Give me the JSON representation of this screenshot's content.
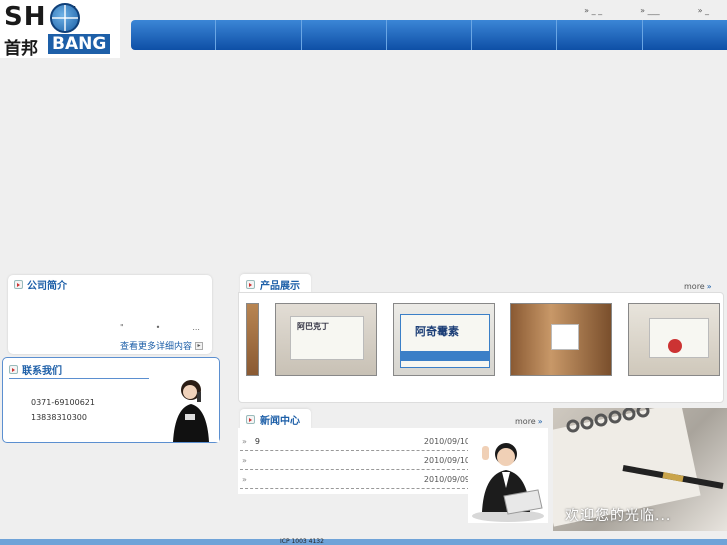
{
  "header": {
    "logo_latin": "SH U",
    "logo_cn": "首邦",
    "logo_badge": "BANG",
    "toplinks": [
      "»  _ _",
      "»  ___",
      "»  _"
    ],
    "nav_items": [
      "",
      "",
      "",
      "",
      "",
      "",
      ""
    ]
  },
  "about": {
    "title": "公司简介",
    "dots": [
      "\"",
      "•",
      "..."
    ],
    "more": "查看更多详细内容"
  },
  "contact": {
    "title": "联系我们",
    "phone1": "0371-69100621",
    "phone2": "13838310300"
  },
  "products": {
    "title": "产品展示",
    "more": "more",
    "more_chevron": "»",
    "items": [
      {
        "label": ""
      },
      {
        "label": "阿巴克丁"
      },
      {
        "label": "阿奇霉素"
      },
      {
        "label": ""
      },
      {
        "label": ""
      }
    ]
  },
  "news": {
    "title": "新闻中心",
    "more": "more",
    "more_chevron": "»",
    "rows": [
      {
        "bullet": "»",
        "text": "9",
        "date": "2010/09/10"
      },
      {
        "bullet": "»",
        "text": "",
        "date": "2010/09/10"
      },
      {
        "bullet": "»",
        "text": "",
        "date": "2010/09/09"
      }
    ]
  },
  "welcome": {
    "text": "欢迎您的光临..."
  },
  "footer": {
    "text": "ICP  1003 4132"
  },
  "colors": {
    "brand_blue": "#1d5fa8",
    "nav_top": "#3b86d6",
    "nav_bottom": "#0e4fa6",
    "footer": "#6fa3d8"
  }
}
